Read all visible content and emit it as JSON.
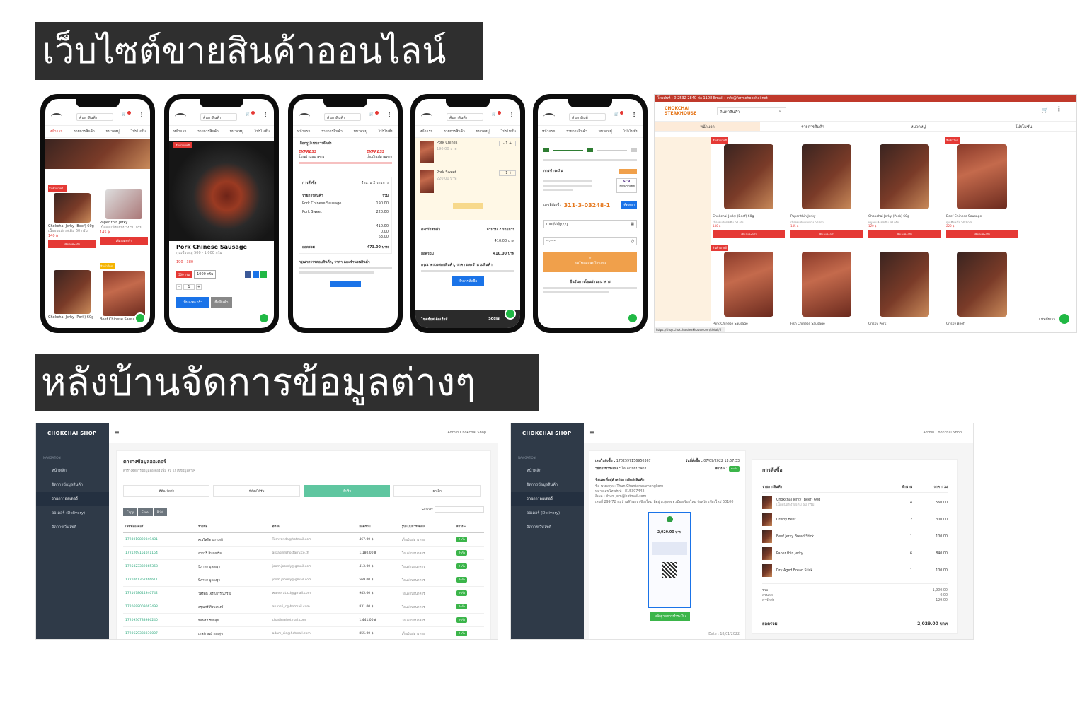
{
  "headings": {
    "storefront": "เว็บไซต์ขายสินค้าออนไลน์",
    "backoffice": "หลังบ้านจัดการข้อมูลต่างๆ"
  },
  "phone_common": {
    "search_placeholder": "ค้นหาสินค้า",
    "nav": [
      "หน้าแรก",
      "รายการสินค้า",
      "หมวดหมู่",
      "โปรโมชั่น"
    ]
  },
  "phone1": {
    "products": [
      {
        "name": "Chokchai Jerky (Beef) 60g",
        "desc": "เนื้ออบแห้งรสเดิม 60 กรัม",
        "price": "140 ฿",
        "badge": "สินค้าขายดี",
        "btn": "เพิ่มลงตะกร้า"
      },
      {
        "name": "Paper thin Jerky",
        "desc": "เนื้ออบแห้งแผ่นบาง 50 กรัม",
        "price": "145 ฿",
        "btn": "เพิ่มลงตะกร้า"
      },
      {
        "name": "Chokchai Jerky (Pork) 60g",
        "price": "",
        "btn": ""
      },
      {
        "name": "Beef Chinese Sausage",
        "price": "",
        "badge": "สินค้าใหม่"
      }
    ]
  },
  "phone2": {
    "badge": "สินค้าขายดี",
    "title": "Pork Chinese Sausage",
    "subtitle": "กุนเชียงหมู 500 - 1,000 กรัม",
    "price": "190 - 380",
    "opt1": "500 กรัม",
    "opt2": "1000 กรัม",
    "add_btn": "เพิ่มลงตะกร้า",
    "buy_btn": "ซื้อสินค้า"
  },
  "phone3": {
    "shipping_title": "เลือกรูปแบบการจัดส่ง",
    "carrier1": "โอนผ่านธนาคาร",
    "carrier2": "เก็บเงินปลายทาง",
    "order_title": "การสั่งซื้อ",
    "order_count": "จำนวน 2 รายการ",
    "col_item": "รายการสินค้า",
    "col_total": "รวม",
    "items": [
      {
        "name": "Pork Chinese Sausage",
        "amount": "190.00"
      },
      {
        "name": "Pork Sweet",
        "amount": "220.00"
      }
    ],
    "sums": [
      "410.00",
      "0.00",
      "63.00"
    ],
    "grand_label": "ยอดรวม",
    "grand_value": "473.00 บาท",
    "notice": "กรุณาตรวจสอบสินค้า, ราคา และจำนวนสินค้า"
  },
  "phone4": {
    "items": [
      {
        "name": "Pork Chines",
        "price": "190.00 บาท"
      },
      {
        "name": "Pork Sweet",
        "price": "220.00 บาท"
      }
    ],
    "cart_title": "ตะกร้าสินค้า",
    "cart_count": "จำนวน 2 รายการ",
    "sub_value": "410.00 บาท",
    "grand_label": "ยอดรวม",
    "grand_value": "410.00 บาท",
    "notice": "กรุณาตรวจสอบสินค้า, ราคา และจำนวนสินค้า",
    "checkout_btn": "ทำการสั่งซื้อ",
    "footer_left": "โชคชัยสเต็กเฮ้าส์",
    "footer_right": "Social"
  },
  "phone5": {
    "pay_title": "การชำระเงิน",
    "bank_logo": "SCB",
    "bank_name": "ไทยพาณิชย์",
    "account_label": "เลขที่บัญชี :",
    "account_no": "311-3-03248-1",
    "copy_btn": "คัดลอก",
    "date_placeholder": "mm/dd/yyyy",
    "time_placeholder": "--:-- --",
    "upload_btn": "อัพโหลดสลิปโอนเงิน",
    "confirm_title": "ยืนยันการโอนผ่านธนาคาร"
  },
  "desktop": {
    "topbar": "โทรศัพท์ : 0 2532 2840 ต่อ 1108   Email : info@farmchokchai.net",
    "brand": "CHOKCHAI STEAKHOUSE",
    "search_placeholder": "ค้นหาสินค้า",
    "nav": [
      "หน้าแรก",
      "รายการสินค้า",
      "หมวดหมู่",
      "โปรโมชั่น"
    ],
    "products": [
      {
        "name": "Chokchai Jerky (Beef) 60g",
        "desc": "เนื้ออบแห้งรสเดิม 60 กรัม",
        "price": "140 ฿",
        "badge": "สินค้าขายดี",
        "btn": "เพิ่มลงตะกร้า"
      },
      {
        "name": "Paper thin Jerky",
        "desc": "เนื้ออบแห้งแผ่นบาง 50 กรัม",
        "price": "145 ฿",
        "btn": "เพิ่มลงตะกร้า"
      },
      {
        "name": "Chokchai Jerky (Pork) 60g",
        "desc": "หมูอบแห้งรสเดิม 60 กรัม",
        "price": "120 ฿",
        "btn": "เพิ่มลงตะกร้า"
      },
      {
        "name": "Beef Chinese Sausage",
        "desc": "กุนเชียงเนื้อ 500 กรัม",
        "price": "220 ฿",
        "badge": "สินค้าใหม่",
        "btn": "เพิ่มลงตะกร้า"
      },
      {
        "name": "Pork Chinese Sausage",
        "badge": "สินค้าขายดี"
      },
      {
        "name": "Fish Chinese Sausage"
      },
      {
        "name": "Crispy Pork"
      },
      {
        "name": "Crispy Beef"
      }
    ],
    "status_url": "https://shop.chokchaisteakhouse.com/detail/2",
    "chat_label": "แชทกับเรา"
  },
  "admin_common": {
    "brand": "CHOKCHAI SHOP",
    "nav_label": "NAVIGATION",
    "user": "Admin Chokchai Shop",
    "menu": [
      "หน้าหลัก",
      "จัดการข้อมูลสินค้า",
      "รายการออเดอร์",
      "ออเดอร์ (Delivery)",
      "จัดการเว็บไซต์"
    ]
  },
  "admin1": {
    "title": "ตารางข้อมูลออเดอร์",
    "subtitle": "ตารางจัดการข้อมูลออเดอร์ เพิ่ม ลบ แก้ไขข้อมูลต่างๆ",
    "tabs": [
      "ที่ต้องจัดส่ง",
      "ที่ต้องได้รับ",
      "สำเร็จ",
      "ยกเลิก"
    ],
    "tools": [
      "Copy",
      "Excel",
      "Print"
    ],
    "search_label": "Search:",
    "columns": [
      "เลขที่ออเดอร์",
      "รายชื่อ",
      "อีเมล",
      "ยอดรวม",
      "รูปแบบการจัดส่ง",
      "สถานะ"
    ],
    "rows": [
      [
        "1723010820049481",
        "คุณโสภิต บรรเทปี",
        "Tumvanda@hotmail.com",
        "467.00 ฿",
        "เก็บเงินปลายทาง",
        "สำเร็จ"
      ],
      [
        "1721269151041154",
        "อาการิ สินจงศรีจ",
        "arpasin@hostarry.co.th",
        "1,180.00 ฿",
        "โอนผ่านธนาคาร",
        "สำเร็จ"
      ],
      [
        "1725823339865368",
        "นิภาพร มูลลงฐา",
        "joom.joomly@gmail.com",
        "413.00 ฿",
        "โอนผ่านธนาคาร",
        "สำเร็จ"
      ],
      [
        "1721061362466611",
        "นิภาพร มูลลงฐา",
        "joom.joomly@gmail.com",
        "569.00 ฿",
        "โอนผ่านธนาคาร",
        "สำเร็จ"
      ],
      [
        "1721078644940742",
        "วลีรัตน์ เจริญวรรณภรณ์",
        "waleerat.cd@gmail.com",
        "945.00 ฿",
        "โอนผ่านธนาคาร",
        "สำเร็จ"
      ],
      [
        "1720698009062498",
        "อรุณศรี ศิวพลพงษ์",
        "arunsri_c@hotmail.com",
        "831.00 ฿",
        "โอนผ่านธนาคาร",
        "สำเร็จ"
      ],
      [
        "1720936783986240",
        "ชุติพร ปริยกสุข",
        "chadin@hotmail.com",
        "1,441.00 ฿",
        "โอนผ่านธนาคาร",
        "สำเร็จ"
      ],
      [
        "1720629383030007",
        "เกษลักษณ์ ทองสุข",
        "adam_cia@hotmail.com",
        "855.00 ฿",
        "เก็บเงินปลายทาง",
        "สำเร็จ"
      ]
    ]
  },
  "admin2": {
    "order_label": "เลขใบสั่งซื้อ :",
    "order_no": "1702597156950367",
    "date_label": "วันที่สั่งซื้อ :",
    "date_value": "07/09/2022 13:57:33",
    "pay_label": "วิธีการชำระเงิน :",
    "pay_value": "โอนผ่านธนาคาร",
    "status_label": "สถานะ :",
    "status_value": "สำเร็จ",
    "ship_title": "ชื่อและที่อยู่สำหรับการจัดส่งสินค้า",
    "ship_name": "ชื่อ-นามสกุล : Thun Chantaranamongkorn",
    "ship_phone": "หมายเลขโทรศัพท์ : 815307442",
    "ship_email": "อีเมล : thun_jom@hotmail.com",
    "ship_addr": "เลขที่ 299/72 หมู่บ้านสิรินธร เชียงใหม่ ที่อยู่ ถ.สุเทพ อ.เมืองเชียงใหม่ จังหวัด เชียงใหม่ 50100",
    "slip_amount": "2,029.00 บาท",
    "slip_btn": "หลักฐานการชำระเงิน",
    "footer_date": "Date : 18/01/2022",
    "order_title": "การสั่งซื้อ",
    "col_item": "รายการสินค้า",
    "col_qty": "จำนวน",
    "col_price": "ราคารวม",
    "items": [
      {
        "name": "Chokchai Jerky (Beef) 60g",
        "sub": "เนื้ออบแห้งรสเดิม 60 กรัม",
        "qty": "4",
        "price": "560.00"
      },
      {
        "name": "Crispy Beef",
        "sub": "",
        "qty": "2",
        "price": "300.00"
      },
      {
        "name": "Beef Jerky Bread Stick",
        "sub": "",
        "qty": "1",
        "price": "100.00"
      },
      {
        "name": "Paper thin Jerky",
        "sub": "",
        "qty": "6",
        "price": "840.00"
      },
      {
        "name": "Dry Aged Bread Stick",
        "sub": "",
        "qty": "1",
        "price": "100.00"
      }
    ],
    "sum_labels": [
      "รวม",
      "ส่วนลด",
      "ค่าจัดส่ง"
    ],
    "sum_values": [
      "1,900.00",
      "0.00",
      "129.00"
    ],
    "grand_label": "ยอดรวม",
    "grand_value": "2,029.00 บาท"
  }
}
